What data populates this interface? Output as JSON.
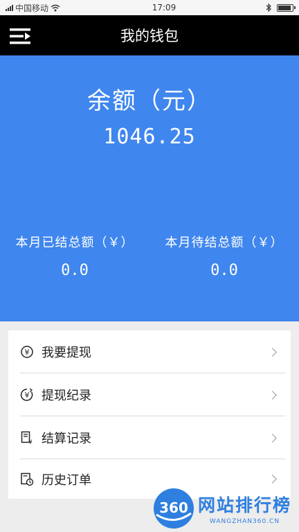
{
  "status_bar": {
    "carrier": "中国移动",
    "time": "17:09",
    "icons": [
      "signal-icon",
      "wifi-icon",
      "bluetooth-icon",
      "battery-icon"
    ],
    "battery_level": 0.9
  },
  "header": {
    "title": "我的钱包",
    "menu_icon": "menu-icon"
  },
  "balance": {
    "label": "余额（元）",
    "amount": "1046.25",
    "settled_label": "本月已结总额（￥）",
    "settled_value": "0.0",
    "pending_label": "本月待结总额（￥）",
    "pending_value": "0.0"
  },
  "menu": {
    "items": [
      {
        "label": "我要提现",
        "icon": "yen-circle-icon"
      },
      {
        "label": "提现纪录",
        "icon": "yen-history-icon"
      },
      {
        "label": "结算记录",
        "icon": "settlement-doc-icon"
      },
      {
        "label": "历史订单",
        "icon": "order-history-icon"
      }
    ]
  },
  "watermark": {
    "logo_text": "360",
    "title": "网站排行榜",
    "subtitle": "WANGZHAN360.CN"
  },
  "colors": {
    "primary_blue": "#3f86ee",
    "header_bg": "#000000",
    "watermark_blue": "#2e7fe0"
  }
}
